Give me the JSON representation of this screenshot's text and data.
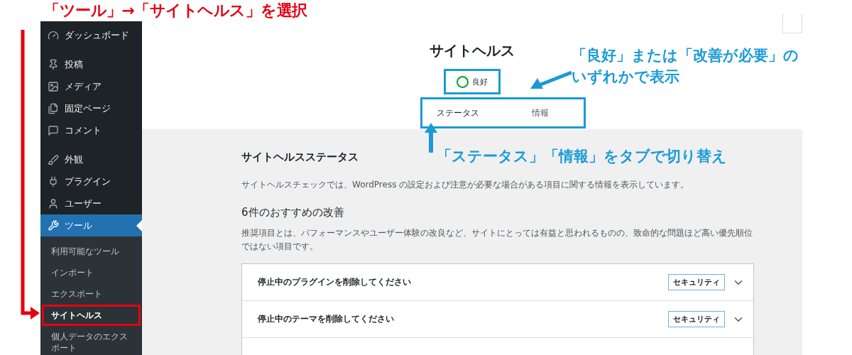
{
  "annotations": {
    "top_label": "「ツール」→「サイトヘルス」を選択",
    "status_note": [
      "「良好」または「改善が必要」の",
      "いずれかで表示"
    ],
    "tabs_note": "「ステータス」「情報」をタブで切り替え"
  },
  "sidebar": {
    "groups": [
      {
        "items": [
          {
            "label": "ダッシュボード",
            "selected": false
          }
        ]
      },
      {
        "items": [
          {
            "label": "投稿",
            "selected": false
          },
          {
            "label": "メディア",
            "selected": false
          },
          {
            "label": "固定ページ",
            "selected": false
          },
          {
            "label": "コメント",
            "selected": false
          }
        ]
      },
      {
        "items": [
          {
            "label": "外観",
            "selected": false
          },
          {
            "label": "プラグイン",
            "selected": false
          },
          {
            "label": "ユーザー",
            "selected": false
          },
          {
            "label": "ツール",
            "selected": true
          }
        ]
      }
    ],
    "submenu": [
      {
        "label": "利用可能なツール",
        "selected": false,
        "highlighted": false
      },
      {
        "label": "インポート",
        "selected": false,
        "highlighted": false
      },
      {
        "label": "エクスポート",
        "selected": false,
        "highlighted": false
      },
      {
        "label": "サイトヘルス",
        "selected": true,
        "highlighted": true
      },
      {
        "label": "個人データのエクスポート",
        "selected": false,
        "highlighted": false
      }
    ]
  },
  "header": {
    "title": "サイトヘルス",
    "status": {
      "label": "良好",
      "kind": "good"
    },
    "tabs": [
      {
        "label": "ステータス",
        "selected": true
      },
      {
        "label": "情報",
        "selected": false
      }
    ]
  },
  "content": {
    "heading": "サイトヘルスステータス",
    "description": "サイトヘルスチェックでは、WordPress の設定および注意が必要な場合がある項目に関する情報を表示しています。",
    "subheading": "6件のおすすめの改善",
    "subdescription": "推奨項目とは、パフォーマンスやユーザー体験の改良など、サイトにとっては有益と思われるものの、致命的な問題ほど高い優先順位ではない項目です。",
    "issues": [
      {
        "kind": "issue",
        "title": "停止中のプラグインを削除してください",
        "badge": "セキュリティ",
        "expanded": false
      },
      {
        "kind": "issue",
        "title": "停止中のテーマを削除してください",
        "badge": "セキュリティ",
        "expanded": false
      },
      {
        "kind": "empty"
      }
    ]
  }
}
